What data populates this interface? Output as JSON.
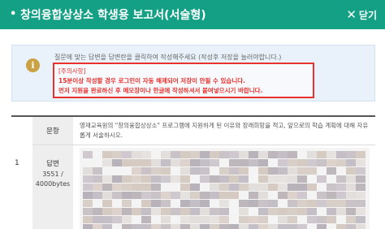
{
  "header": {
    "bullet": "•",
    "title": "창의융합상상소 학생용 보고서(서술형)",
    "close_label": "닫기",
    "close_icon": "✕",
    "bg_color": "#13a085"
  },
  "notice": {
    "icon": "i",
    "instruction": "질문에 맞는 답변을 답변란을 클릭하여 작성해주세요 (작성후 저장을 눌러야합니다.)",
    "warning_title": "[주의사항]",
    "warning_line1": "15분이상 작성할 경우 로그인이 자동 해제되어 저장이 안될 수 있습니다.",
    "warning_line2": "먼저 지원을 완료하신 후 메모장이나 한글에 작성하셔서 붙여넣으시기 바랍니다.",
    "warning_color": "#e8322e"
  },
  "question_table": {
    "row_number": "1",
    "question_label": "문항",
    "answer_label": "답변",
    "char_count": "3551 /",
    "char_limit": "4000bytes",
    "question_text": "영재교육원의 \"창의융합상상소\" 프로그램에 지원하게 된 이유와 장래희망을 적고, 앞으로의 학습 계획에 대해 자유롭게 서술하시오."
  }
}
